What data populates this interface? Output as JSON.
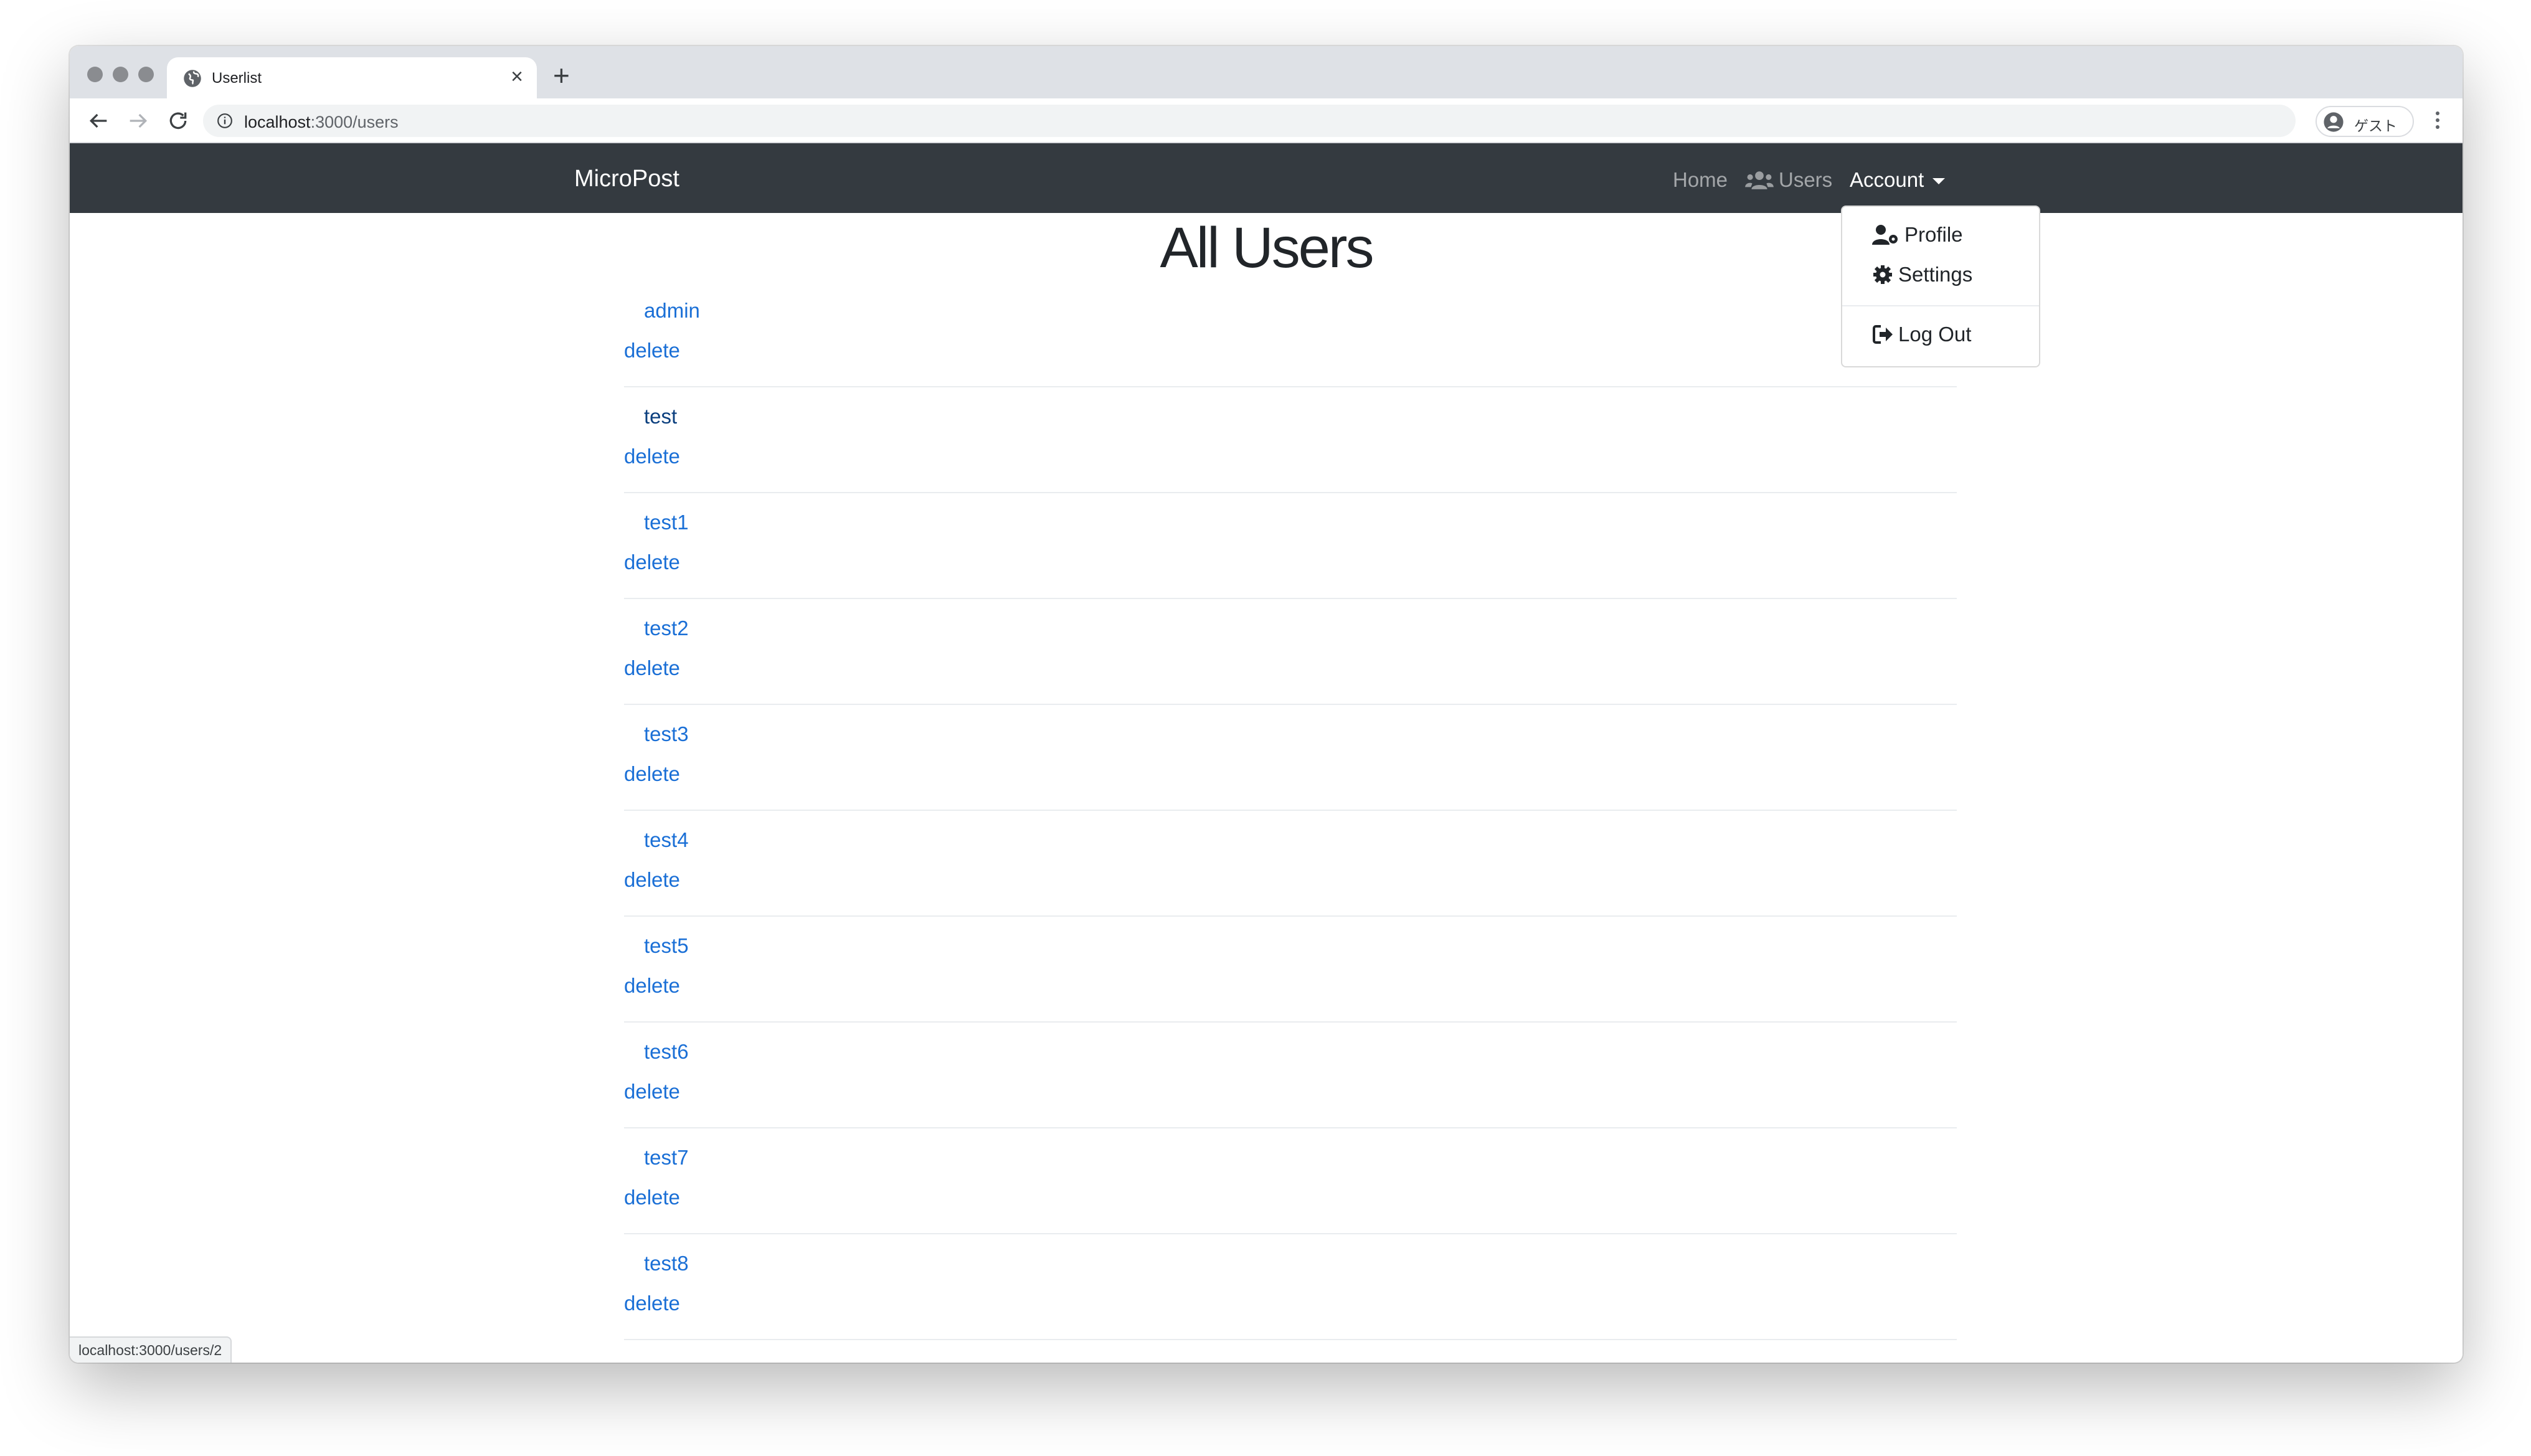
{
  "browser": {
    "tab_title": "Userlist",
    "tab_close": "×",
    "new_tab": "+",
    "url_host": "localhost",
    "url_path": ":3000/users",
    "profile_label": "ゲスト",
    "status_url": "localhost:3000/users/2"
  },
  "navbar": {
    "brand": "MicroPost",
    "home": "Home",
    "users": "Users",
    "account": "Account"
  },
  "dropdown": {
    "profile": "Profile",
    "settings": "Settings",
    "logout": "Log Out"
  },
  "main": {
    "title": "All Users",
    "delete_label": "delete",
    "users": [
      "admin",
      "test",
      "test1",
      "test2",
      "test3",
      "test4",
      "test5",
      "test6",
      "test7",
      "test8"
    ]
  },
  "icons": {
    "favicon": "globe-icon",
    "users": "users-icon",
    "profile": "user-cog-icon",
    "settings": "gear-icon",
    "logout": "sign-out-icon"
  }
}
